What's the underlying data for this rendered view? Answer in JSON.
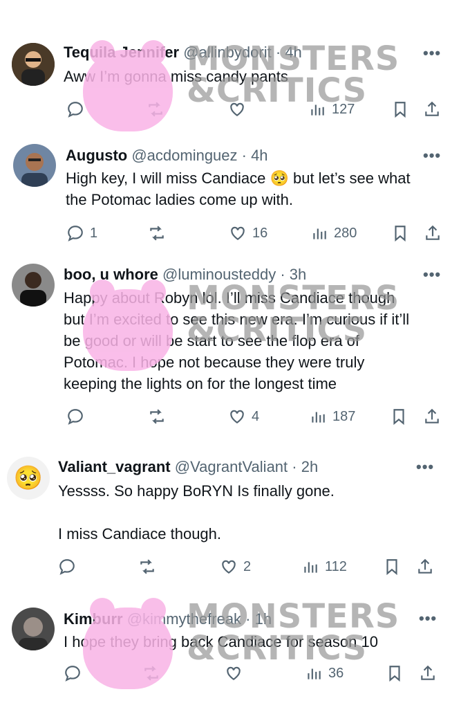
{
  "tweets": [
    {
      "name": "Tequila Jennifer",
      "handle": "@allinbydorit · 4h",
      "text": "Aww I’m gonna miss candy pants",
      "replies": "",
      "reposts": "",
      "likes": "",
      "views": "127",
      "avatar_color": "#5a4630"
    },
    {
      "name": "Augusto",
      "handle": "@acdominguez · 4h",
      "text": "High key, I will miss Candiace 🥺 but let’s see what\nthe Potomac ladies come up with.",
      "replies": "1",
      "reposts": "",
      "likes": "16",
      "views": "280",
      "avatar_color": "#3d4e67"
    },
    {
      "name": "boo, u whore",
      "handle": "@luminousteddy · 3h",
      "text": "Happy about Robyn lol. I’ll miss Candiace though\nbut I’m excited to see this new era. I’m curious if it’ll\nbe good or will be start to see the flop era of\nPotomac. I hope not because they were truly\nkeeping the lights on for the longest time",
      "replies": "",
      "reposts": "",
      "likes": "4",
      "views": "187",
      "avatar_color": "#2a2a2a"
    },
    {
      "name": "Valiant_vagrant",
      "handle": "@VagrantValiant · 2h",
      "text": "Yessss. So happy BoRYN Is finally gone.\n\nI miss Candiace though.",
      "replies": "",
      "reposts": "",
      "likes": "2",
      "views": "112",
      "avatar_emoji": "🥺"
    },
    {
      "name": "Kimburr",
      "handle": "@kimmythefreak · 1h",
      "text": "I hope they bring back Candiace for season 10",
      "replies": "",
      "reposts": "",
      "likes": "",
      "views": "36",
      "avatar_color": "#6b6b6b"
    }
  ],
  "more_label": "•••",
  "watermark": {
    "line1": "MONSTERS",
    "line2": "&CRITICS"
  }
}
